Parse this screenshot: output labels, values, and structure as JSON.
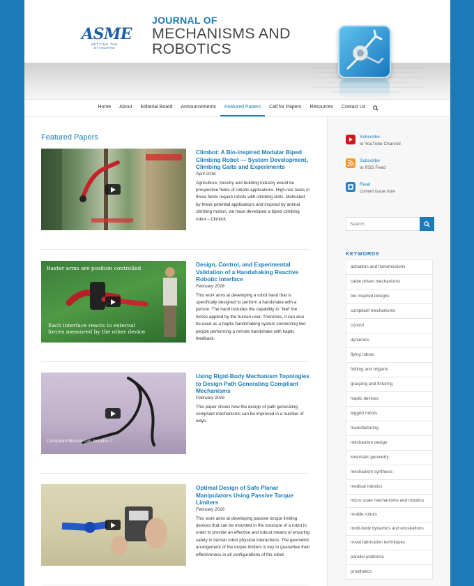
{
  "header": {
    "logo_word": "ASME",
    "logo_tagline": "SETTING THE STANDARD",
    "journal_line1": "JOURNAL OF",
    "journal_line2": "MECHANISMS AND",
    "journal_line3": "ROBOTICS"
  },
  "nav": {
    "items": [
      "Home",
      "About",
      "Editorial Board",
      "Announcements",
      "Featured Papers",
      "Call for Papers",
      "Resources",
      "Contact Us"
    ],
    "active": "Featured Papers"
  },
  "main": {
    "section_title": "Featured Papers",
    "articles": [
      {
        "title": "Climbot: A Bio-inspired Modular Biped Climbing Robot — System Development, Climbing Gaits and Experiments",
        "date": "April 2016",
        "abstract": "Agriculture, forestry and building industry would be prospective fields of robotic applications. High-rise tasks in these fields require robots with climbing skills. Motivated by these potential applications and inspired by animal climbing motion, we have developed a biped climbing robot – Climbot."
      },
      {
        "title": "Design, Control, and Experimental Validation of a Handshaking Reactive Robotic Interface",
        "date": "February 2016",
        "abstract": "This work aims at developing a robot hand that is specifically designed to perform a handshake with a person. The hand includes the capability to `feel' the forces applied by the human user. Therefore, it can also be used as a haptic handshaking system connecting two people performing a remote handshake with haptic feedback.",
        "thumb_caption_top": "Baxter arms are position controlled",
        "thumb_caption_bottom": "Each interface reacts to external forces measured by the other device"
      },
      {
        "title": "Using Rigid-Body Mechanism Topologies to Design Path Generating Compliant Mechanisms",
        "date": "February 2016",
        "abstract": "This paper shows how the design of path generating compliant mechanisms can be improved in a number of ways.",
        "thumb_caption": "Compliant Mechanism Solution 1"
      },
      {
        "title": "Optimal Design of Safe Planar Manipulators Using Passive Torque Limiters",
        "date": "February 2016",
        "abstract": "This work aims at developing passive torque limiting devices that can be mounted in the structure of a robot in order to provide an effective and robust means of ensuring safety in human robot physical interactions. The geometric arrangement of the torque limiters is key to guarantee their effectiveness in all configurations of the robot."
      }
    ]
  },
  "sidebar": {
    "subscriptions": [
      {
        "icon": "youtube-icon",
        "line1": "Subscribe",
        "line2": "to YouTube Channel",
        "color": "#cc181e"
      },
      {
        "icon": "rss-icon",
        "line1": "Subscribe",
        "line2": "to RSS Feed",
        "color": "#f39a2b"
      },
      {
        "icon": "issue-icon",
        "line1": "Read",
        "line2": "current issue now",
        "color": "#2a7fbf"
      }
    ],
    "search_placeholder": "Search",
    "keywords_title": "KEYWORDS",
    "keywords": [
      "actuators and transmissions",
      "cable driven mechanisms",
      "bio inspired designs",
      "compliant mechanisms",
      "control",
      "dynamics",
      "flying robots",
      "folding and origami",
      "grasping and fixturing",
      "haptic devices",
      "legged robots",
      "manufacturing",
      "mechanism design",
      "kinematic geometry",
      "mechanism synthesis",
      "medical robotics",
      "micro scale mechanisms and robotics",
      "mobile robots",
      "multi-body dynamics and exoskeltons",
      "novel fabrication techniques",
      "parallel platforms",
      "prosthetics"
    ]
  },
  "colors": {
    "brand": "#1a7bb8",
    "frame": "#1a7bb8"
  }
}
